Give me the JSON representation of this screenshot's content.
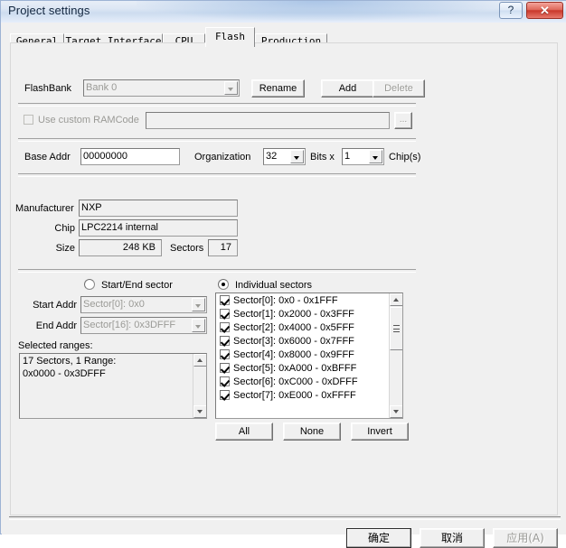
{
  "window": {
    "title": "Project settings",
    "help_button": "?",
    "close_button": "✕"
  },
  "tabs": [
    {
      "label": "General",
      "active": false
    },
    {
      "label": "Target Interface",
      "active": false
    },
    {
      "label": "CPU",
      "active": false
    },
    {
      "label": "Flash",
      "active": true
    },
    {
      "label": "Production",
      "active": false
    }
  ],
  "flash_tab": {
    "flashbank": {
      "label": "FlashBank",
      "value": "Bank 0",
      "rename_button": "Rename",
      "add_button": "Add",
      "delete_button": "Delete"
    },
    "ramcode": {
      "checkbox_label": "Use custom RAMCode",
      "checked": false,
      "path_value": "",
      "path_placeholder": "",
      "browse_button": "..."
    },
    "memory": {
      "base_addr_label": "Base Addr",
      "base_addr_value": "00000000",
      "organization_label": "Organization",
      "organization_value": "32",
      "bits_label": "Bits x",
      "chips_value": "1",
      "chips_label": "Chip(s)"
    },
    "device": {
      "manufacturer_label": "Manufacturer",
      "manufacturer_value": "NXP",
      "chip_label": "Chip",
      "chip_value": "LPC2214 internal",
      "size_label": "Size",
      "size_value": "248 KB",
      "sectors_label": "Sectors",
      "sectors_value": "17"
    },
    "selection": {
      "start_end_radio": "Start/End sector",
      "start_end_selected": false,
      "individual_radio": "Individual sectors",
      "individual_selected": true,
      "start_addr_label": "Start Addr",
      "start_addr_value": "Sector[0]: 0x0",
      "end_addr_label": "End Addr",
      "end_addr_value": "Sector[16]: 0x3DFFF",
      "selected_ranges_label": "Selected ranges:",
      "selected_ranges_lines": "17 Sectors, 1 Range:\n0x0000 - 0x3DFFF",
      "sectors": [
        {
          "label": "Sector[0]: 0x0 - 0x1FFF",
          "checked": true
        },
        {
          "label": "Sector[1]: 0x2000 - 0x3FFF",
          "checked": true
        },
        {
          "label": "Sector[2]: 0x4000 - 0x5FFF",
          "checked": true
        },
        {
          "label": "Sector[3]: 0x6000 - 0x7FFF",
          "checked": true
        },
        {
          "label": "Sector[4]: 0x8000 - 0x9FFF",
          "checked": true
        },
        {
          "label": "Sector[5]: 0xA000 - 0xBFFF",
          "checked": true
        },
        {
          "label": "Sector[6]: 0xC000 - 0xDFFF",
          "checked": true
        },
        {
          "label": "Sector[7]: 0xE000 - 0xFFFF",
          "checked": true
        }
      ],
      "all_button": "All",
      "none_button": "None",
      "invert_button": "Invert"
    }
  },
  "footer": {
    "ok_button": "确定",
    "cancel_button": "取消",
    "apply_button": "应用(A)"
  }
}
